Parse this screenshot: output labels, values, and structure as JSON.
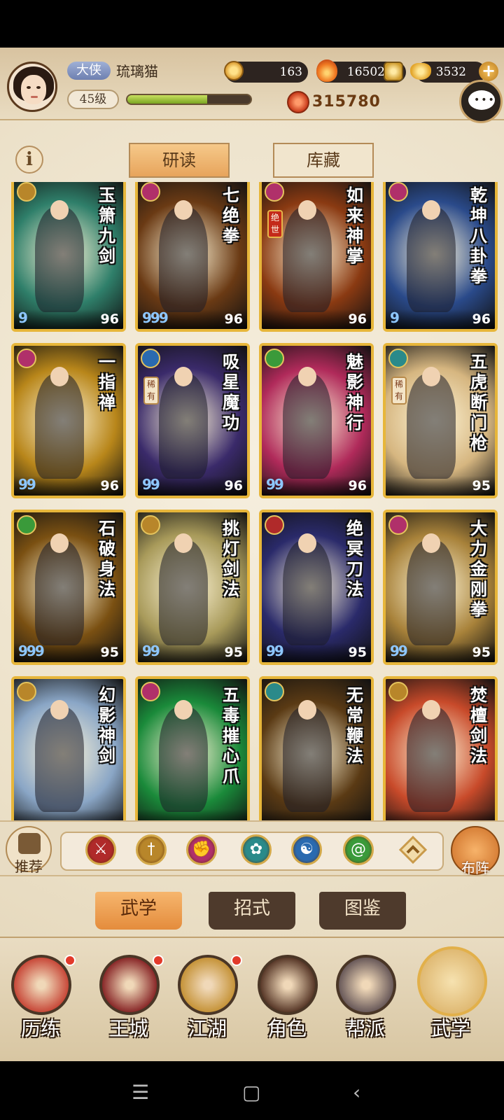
{
  "player": {
    "title": "大侠",
    "name": "琉璃猫",
    "level": "45级",
    "exp_fraction": 0.65,
    "power": "315780"
  },
  "resources": {
    "coins": "163",
    "flame": "16502",
    "gold": "3532"
  },
  "top_tabs": {
    "study": "研读",
    "storage": "库藏"
  },
  "cards": [
    {
      "name": "玉箫九剑",
      "score": "96",
      "drops": "9",
      "school_color": "#b8862a",
      "art": "#2f7f6a"
    },
    {
      "name": "七绝拳",
      "score": "96",
      "drops": "999",
      "school_color": "#b0306a",
      "art": "#6a3a14"
    },
    {
      "name": "如来神掌",
      "score": "96",
      "drops": "",
      "tag": "绝世",
      "school_color": "#b0306a",
      "art": "#8a3a12"
    },
    {
      "name": "乾坤八卦拳",
      "score": "96",
      "drops": "9",
      "school_color": "#b0306a",
      "art": "#2a4a8a"
    },
    {
      "name": "一指禅",
      "score": "96",
      "drops": "99",
      "school_color": "#b0306a",
      "art": "#b8861a"
    },
    {
      "name": "吸星魔功",
      "score": "96",
      "drops": "99",
      "tag": "稀有",
      "school_color": "#2a6ab0",
      "art": "#3a2a6a"
    },
    {
      "name": "魅影神行",
      "score": "96",
      "drops": "99",
      "school_color": "#3a9a3a",
      "art": "#b02a5a"
    },
    {
      "name": "五虎断门枪",
      "score": "95",
      "drops": "",
      "tag": "稀有",
      "school_color": "#2a8a8a",
      "art": "#d6b680"
    },
    {
      "name": "石破身法",
      "score": "95",
      "drops": "999",
      "school_color": "#3a9a3a",
      "art": "#7a5012"
    },
    {
      "name": "挑灯剑法",
      "score": "95",
      "drops": "99",
      "school_color": "#b8862a",
      "art": "#a89a5a"
    },
    {
      "name": "绝冥刀法",
      "score": "95",
      "drops": "99",
      "school_color": "#b02a2a",
      "art": "#2a2a6a"
    },
    {
      "name": "大力金刚拳",
      "score": "95",
      "drops": "99",
      "school_color": "#b0306a",
      "art": "#a8823a"
    },
    {
      "name": "幻影神剑",
      "score": "",
      "drops": "",
      "school_color": "#b8862a",
      "art": "#8aa6c6"
    },
    {
      "name": "五毒摧心爪",
      "score": "",
      "drops": "",
      "school_color": "#b0306a",
      "art": "#1a8a3a"
    },
    {
      "name": "无常鞭法",
      "score": "",
      "drops": "",
      "school_color": "#2a8a8a",
      "art": "#5a3a14"
    },
    {
      "name": "焚檀剑法",
      "score": "",
      "drops": "",
      "school_color": "#b8862a",
      "art": "#c84a2a"
    }
  ],
  "filter": {
    "recommend": "推荐",
    "layout": "布阵",
    "schools": [
      {
        "icon": "blade-icon",
        "color": "#b02a2a",
        "glyph": "⚔"
      },
      {
        "icon": "sword-icon",
        "color": "#b8862a",
        "glyph": "†"
      },
      {
        "icon": "fist-icon",
        "color": "#b0306a",
        "glyph": "✊"
      },
      {
        "icon": "fan-icon",
        "color": "#2a8a8a",
        "glyph": "✿"
      },
      {
        "icon": "taiji-icon",
        "color": "#2a6ab0",
        "glyph": "☯"
      },
      {
        "icon": "swirl-icon",
        "color": "#3a9a3a",
        "glyph": "@"
      }
    ]
  },
  "sub_tabs": {
    "martial": "武学",
    "moves": "招式",
    "atlas": "图鉴"
  },
  "nav": [
    {
      "label": "历练",
      "icon": "training-icon",
      "color": "#c84a3a",
      "dot": true
    },
    {
      "label": "王城",
      "icon": "castle-icon",
      "color": "#8a2a2a",
      "dot": true
    },
    {
      "label": "江湖",
      "icon": "jianghu-icon",
      "color": "#c6943a",
      "dot": true
    },
    {
      "label": "角色",
      "icon": "character-icon",
      "color": "#5a3a2a",
      "dot": false
    },
    {
      "label": "帮派",
      "icon": "guild-icon",
      "color": "#6a5a5a",
      "dot": false
    },
    {
      "label": "武学",
      "icon": "scroll-icon",
      "color": "#d6a85a",
      "dot": false,
      "selected": true
    }
  ]
}
